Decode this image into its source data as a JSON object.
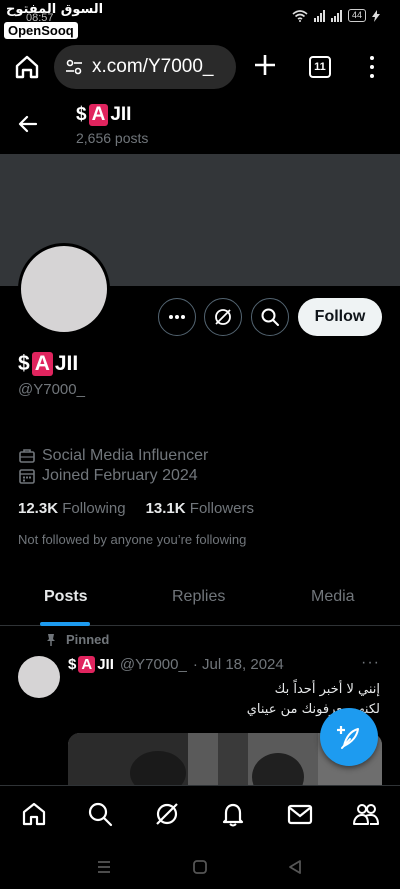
{
  "watermark": {
    "arabic": "السوق المفتوح",
    "time": "08:57",
    "logo": "OpenSooq"
  },
  "status": {
    "battery": "44"
  },
  "browser": {
    "url": "x.com/Y7000_",
    "tab_count": "11"
  },
  "profile": {
    "name_prefix": "$",
    "name_badge": "A",
    "name_suffix": "JII",
    "posts_count": "2,656 posts",
    "handle": "@Y7000_",
    "category": "Social Media Influencer",
    "joined": "Joined February 2024",
    "following_count": "12.3K",
    "following_label": "Following",
    "followers_count": "13.1K",
    "followers_label": "Followers",
    "not_followed": "Not followed by anyone you’re following",
    "follow_label": "Follow"
  },
  "tabs": [
    {
      "label": "Posts",
      "active": true
    },
    {
      "label": "Replies",
      "active": false
    },
    {
      "label": "Media",
      "active": false
    }
  ],
  "post": {
    "pinned_label": "Pinned",
    "handle": "@Y7000_",
    "date": "· Jul 18, 2024",
    "more": "···",
    "line1": "إنني لا أخبر أحداً بك",
    "line2": "لكنهم يعرفونك من عيناي"
  },
  "colors": {
    "accent": "#1d9bf0",
    "badge": "#e0245e",
    "banner": "#333639"
  }
}
